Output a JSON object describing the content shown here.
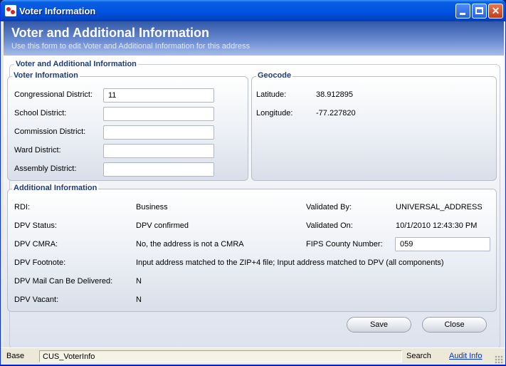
{
  "window": {
    "title": "Voter Information"
  },
  "header": {
    "title": "Voter and Additional Information",
    "subtitle": "Use this form to edit Voter and Additional Information for this address"
  },
  "outer_group": {
    "title": "Voter and Additional Information"
  },
  "voter_info": {
    "title": "Voter Information",
    "congressional_label": "Congressional District:",
    "congressional_value": "11",
    "school_label": "School District:",
    "school_value": "",
    "commission_label": "Commission District:",
    "commission_value": "",
    "ward_label": "Ward District:",
    "ward_value": "",
    "assembly_label": "Assembly District:",
    "assembly_value": ""
  },
  "geocode": {
    "title": "Geocode",
    "latitude_label": "Latitude:",
    "latitude_value": "38.912895",
    "longitude_label": "Longitude:",
    "longitude_value": "-77.227820"
  },
  "additional_info": {
    "title": "Additional Information",
    "rdi_label": "RDI:",
    "rdi_value": "Business",
    "dpv_status_label": "DPV Status:",
    "dpv_status_value": "DPV confirmed",
    "dpv_cmra_label": "DPV CMRA:",
    "dpv_cmra_value": "No, the address is not a CMRA",
    "dpv_footnote_label": "DPV Footnote:",
    "dpv_footnote_value": "Input address matched to the ZIP+4 file; Input address matched to DPV (all components)",
    "dpv_mail_label": "DPV Mail Can Be Delivered:",
    "dpv_mail_value": "N",
    "dpv_vacant_label": "DPV Vacant:",
    "dpv_vacant_value": "N",
    "validated_by_label": "Validated By:",
    "validated_by_value": "UNIVERSAL_ADDRESS",
    "validated_on_label": "Validated On:",
    "validated_on_value": "10/1/2010 12:43:30 PM",
    "fips_label": "FIPS County Number:",
    "fips_value": "059"
  },
  "buttons": {
    "save": "Save",
    "close": "Close"
  },
  "statusbar": {
    "base": "Base",
    "form": "CUS_VoterInfo",
    "search": "Search",
    "audit": "Audit Info"
  }
}
